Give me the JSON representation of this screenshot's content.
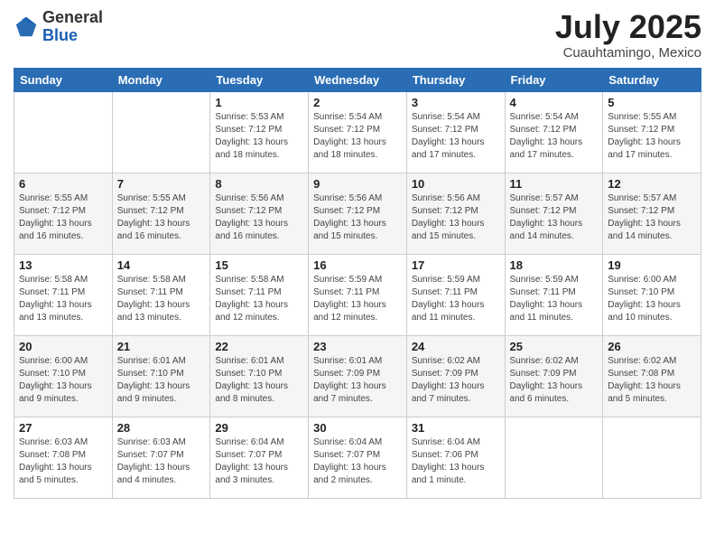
{
  "header": {
    "logo_general": "General",
    "logo_blue": "Blue",
    "month_title": "July 2025",
    "location": "Cuauhtamingo, Mexico"
  },
  "days_of_week": [
    "Sunday",
    "Monday",
    "Tuesday",
    "Wednesday",
    "Thursday",
    "Friday",
    "Saturday"
  ],
  "weeks": [
    [
      {
        "day": "",
        "info": ""
      },
      {
        "day": "",
        "info": ""
      },
      {
        "day": "1",
        "info": "Sunrise: 5:53 AM\nSunset: 7:12 PM\nDaylight: 13 hours\nand 18 minutes."
      },
      {
        "day": "2",
        "info": "Sunrise: 5:54 AM\nSunset: 7:12 PM\nDaylight: 13 hours\nand 18 minutes."
      },
      {
        "day": "3",
        "info": "Sunrise: 5:54 AM\nSunset: 7:12 PM\nDaylight: 13 hours\nand 17 minutes."
      },
      {
        "day": "4",
        "info": "Sunrise: 5:54 AM\nSunset: 7:12 PM\nDaylight: 13 hours\nand 17 minutes."
      },
      {
        "day": "5",
        "info": "Sunrise: 5:55 AM\nSunset: 7:12 PM\nDaylight: 13 hours\nand 17 minutes."
      }
    ],
    [
      {
        "day": "6",
        "info": "Sunrise: 5:55 AM\nSunset: 7:12 PM\nDaylight: 13 hours\nand 16 minutes."
      },
      {
        "day": "7",
        "info": "Sunrise: 5:55 AM\nSunset: 7:12 PM\nDaylight: 13 hours\nand 16 minutes."
      },
      {
        "day": "8",
        "info": "Sunrise: 5:56 AM\nSunset: 7:12 PM\nDaylight: 13 hours\nand 16 minutes."
      },
      {
        "day": "9",
        "info": "Sunrise: 5:56 AM\nSunset: 7:12 PM\nDaylight: 13 hours\nand 15 minutes."
      },
      {
        "day": "10",
        "info": "Sunrise: 5:56 AM\nSunset: 7:12 PM\nDaylight: 13 hours\nand 15 minutes."
      },
      {
        "day": "11",
        "info": "Sunrise: 5:57 AM\nSunset: 7:12 PM\nDaylight: 13 hours\nand 14 minutes."
      },
      {
        "day": "12",
        "info": "Sunrise: 5:57 AM\nSunset: 7:12 PM\nDaylight: 13 hours\nand 14 minutes."
      }
    ],
    [
      {
        "day": "13",
        "info": "Sunrise: 5:58 AM\nSunset: 7:11 PM\nDaylight: 13 hours\nand 13 minutes."
      },
      {
        "day": "14",
        "info": "Sunrise: 5:58 AM\nSunset: 7:11 PM\nDaylight: 13 hours\nand 13 minutes."
      },
      {
        "day": "15",
        "info": "Sunrise: 5:58 AM\nSunset: 7:11 PM\nDaylight: 13 hours\nand 12 minutes."
      },
      {
        "day": "16",
        "info": "Sunrise: 5:59 AM\nSunset: 7:11 PM\nDaylight: 13 hours\nand 12 minutes."
      },
      {
        "day": "17",
        "info": "Sunrise: 5:59 AM\nSunset: 7:11 PM\nDaylight: 13 hours\nand 11 minutes."
      },
      {
        "day": "18",
        "info": "Sunrise: 5:59 AM\nSunset: 7:11 PM\nDaylight: 13 hours\nand 11 minutes."
      },
      {
        "day": "19",
        "info": "Sunrise: 6:00 AM\nSunset: 7:10 PM\nDaylight: 13 hours\nand 10 minutes."
      }
    ],
    [
      {
        "day": "20",
        "info": "Sunrise: 6:00 AM\nSunset: 7:10 PM\nDaylight: 13 hours\nand 9 minutes."
      },
      {
        "day": "21",
        "info": "Sunrise: 6:01 AM\nSunset: 7:10 PM\nDaylight: 13 hours\nand 9 minutes."
      },
      {
        "day": "22",
        "info": "Sunrise: 6:01 AM\nSunset: 7:10 PM\nDaylight: 13 hours\nand 8 minutes."
      },
      {
        "day": "23",
        "info": "Sunrise: 6:01 AM\nSunset: 7:09 PM\nDaylight: 13 hours\nand 7 minutes."
      },
      {
        "day": "24",
        "info": "Sunrise: 6:02 AM\nSunset: 7:09 PM\nDaylight: 13 hours\nand 7 minutes."
      },
      {
        "day": "25",
        "info": "Sunrise: 6:02 AM\nSunset: 7:09 PM\nDaylight: 13 hours\nand 6 minutes."
      },
      {
        "day": "26",
        "info": "Sunrise: 6:02 AM\nSunset: 7:08 PM\nDaylight: 13 hours\nand 5 minutes."
      }
    ],
    [
      {
        "day": "27",
        "info": "Sunrise: 6:03 AM\nSunset: 7:08 PM\nDaylight: 13 hours\nand 5 minutes."
      },
      {
        "day": "28",
        "info": "Sunrise: 6:03 AM\nSunset: 7:07 PM\nDaylight: 13 hours\nand 4 minutes."
      },
      {
        "day": "29",
        "info": "Sunrise: 6:04 AM\nSunset: 7:07 PM\nDaylight: 13 hours\nand 3 minutes."
      },
      {
        "day": "30",
        "info": "Sunrise: 6:04 AM\nSunset: 7:07 PM\nDaylight: 13 hours\nand 2 minutes."
      },
      {
        "day": "31",
        "info": "Sunrise: 6:04 AM\nSunset: 7:06 PM\nDaylight: 13 hours\nand 1 minute."
      },
      {
        "day": "",
        "info": ""
      },
      {
        "day": "",
        "info": ""
      }
    ]
  ]
}
